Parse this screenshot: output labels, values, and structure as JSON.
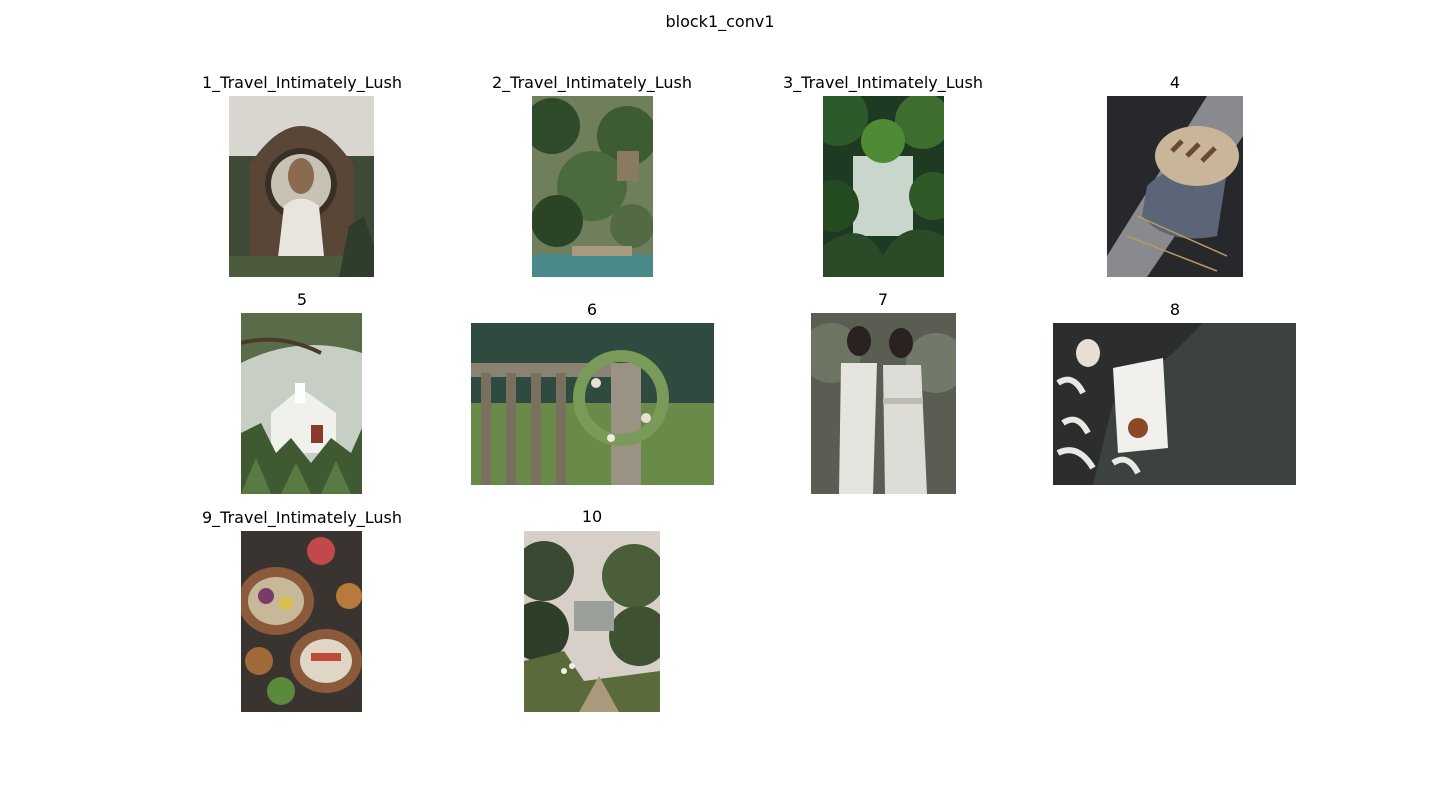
{
  "figure": {
    "title": "block1_conv1",
    "tiles": [
      {
        "title": "1_Travel_Intimately_Lush",
        "subject": "woman-in-circular-arch-image"
      },
      {
        "title": "2_Travel_Intimately_Lush",
        "subject": "tropical-garden-pool-image"
      },
      {
        "title": "3_Travel_Intimately_Lush",
        "subject": "jungle-foliage-image"
      },
      {
        "title": "4",
        "subject": "bread-loaf-on-cloth-image"
      },
      {
        "title": "5",
        "subject": "white-chapel-in-trees-image"
      },
      {
        "title": "6",
        "subject": "flower-wreath-on-fence-image"
      },
      {
        "title": "7",
        "subject": "two-women-in-white-jumpsuits-image"
      },
      {
        "title": "8",
        "subject": "book-on-grey-fabric-image"
      },
      {
        "title": "9_Travel_Intimately_Lush",
        "subject": "food-bowls-on-table-image"
      },
      {
        "title": "10",
        "subject": "garden-path-with-trees-image"
      }
    ]
  }
}
